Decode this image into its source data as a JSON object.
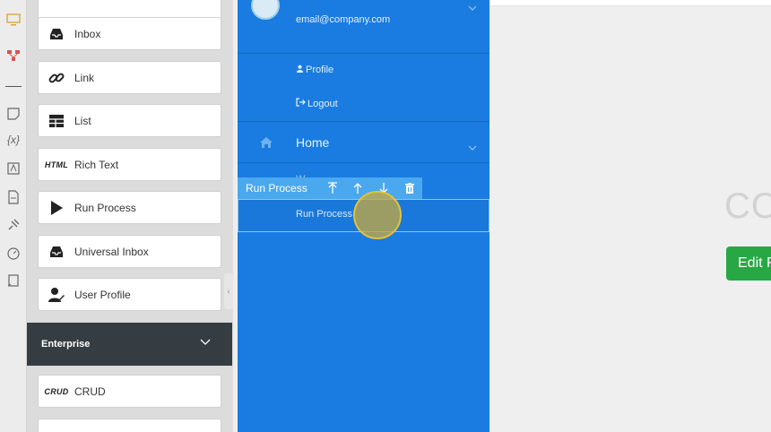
{
  "rail": {
    "icons": [
      "desktop-icon",
      "flow-icon",
      "note-icon",
      "variable-icon",
      "translate-icon",
      "document-icon",
      "plug-icon",
      "gauge-icon",
      "script-icon"
    ]
  },
  "palette": {
    "items_top": [
      {
        "label": "Inbox",
        "icon": "inbox-icon"
      },
      {
        "label": "Link",
        "icon": "link-icon"
      },
      {
        "label": "List",
        "icon": "table-icon"
      },
      {
        "label": "Rich Text",
        "icon": "html-icon",
        "icon_text": "HTML"
      },
      {
        "label": "Run Process",
        "icon": "play-icon"
      },
      {
        "label": "Universal Inbox",
        "icon": "inbox-icon"
      },
      {
        "label": "User Profile",
        "icon": "user-edit-icon"
      }
    ],
    "section": {
      "label": "Enterprise"
    },
    "items_bottom": [
      {
        "label": "CRUD",
        "icon": "crud-icon",
        "icon_text": "CRUD"
      }
    ]
  },
  "menu": {
    "email": "email@company.com",
    "profile_label": "Profile",
    "logout_label": "Logout",
    "home_label": "Home",
    "selected_label": "Run Process"
  },
  "toolbar": {
    "component_name": "Run Process",
    "buttons": [
      "move-up-icon",
      "arrow-up-icon",
      "arrow-down-icon",
      "delete-icon"
    ]
  },
  "canvas": {
    "heading_fragment": "CO",
    "edit_button_label": "Edit F"
  },
  "colors": {
    "menu_blue": "#1a7ce0",
    "toolbar_blue": "#4aa8ee",
    "section_dark": "#363d42",
    "edit_green": "#27a845"
  }
}
